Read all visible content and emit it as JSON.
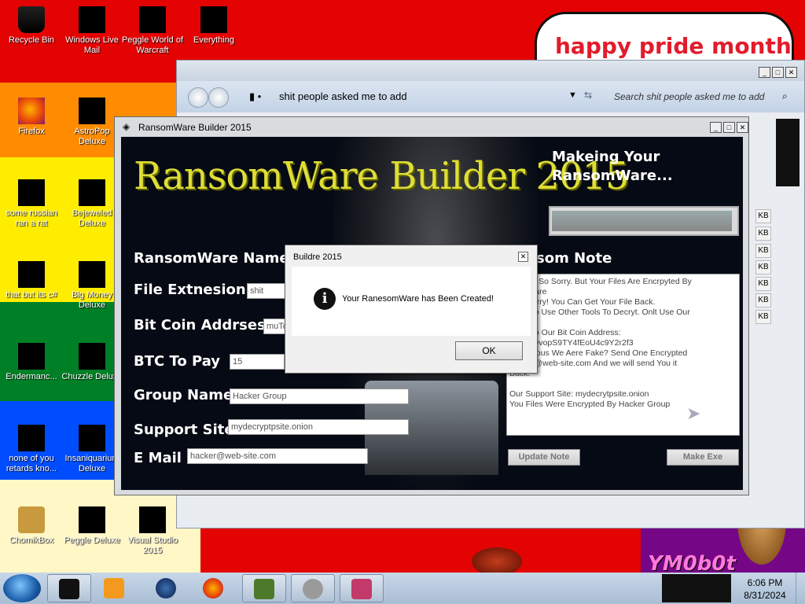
{
  "desktop": {
    "banner": "happy pride month",
    "signature": "YM0b0t",
    "icons": [
      {
        "label": "Recycle Bin",
        "icon": "recycle-bin-icon"
      },
      {
        "label": "Windows Live Mail",
        "icon": "mail-icon"
      },
      {
        "label": "Peggle World of Warcraft",
        "icon": "peggle-icon"
      },
      {
        "label": "Everything",
        "icon": "search-icon"
      },
      {
        "label": "Firefox",
        "icon": "firefox-icon"
      },
      {
        "label": "AstroPop Deluxe",
        "icon": "game-icon"
      },
      {
        "label": "some russian ran a rat",
        "icon": "ie-icon"
      },
      {
        "label": "Bejeweled Deluxe",
        "icon": "gem-icon"
      },
      {
        "label": "that but its c#",
        "icon": "shortcut-icon"
      },
      {
        "label": "Big Money Deluxe",
        "icon": "money-icon"
      },
      {
        "label": "Endermanc...",
        "icon": "app-icon"
      },
      {
        "label": "Chuzzle Deluxe",
        "icon": "chuzzle-icon"
      },
      {
        "label": "none of you retards kno...",
        "icon": "folder-icon"
      },
      {
        "label": "Insaniquarium Deluxe",
        "icon": "fish-icon"
      },
      {
        "label": "ChomikBox",
        "icon": "hamster-icon"
      },
      {
        "label": "Peggle Deluxe",
        "icon": "peggle-icon"
      },
      {
        "label": "Visual Studio 2015",
        "icon": "visual-studio-icon"
      }
    ]
  },
  "explorer": {
    "address": "shit people asked me to add",
    "search_placeholder": "Search shit people asked me to add",
    "size_unit": "KB"
  },
  "builder": {
    "window_title": "RansomWare Builder 2015",
    "logo": "RansomWare Builder 2015",
    "status_title": "Makeing Your RansomWare...",
    "progress": 0.98,
    "fields": {
      "ransomware_name_label": "RansomWare Name",
      "file_extension_label": "File Extnesion",
      "file_extension_value": "shit",
      "bitcoin_address_label": "Bit Coin Addrses",
      "bitcoin_address_value": "muTc",
      "btc_to_pay_label": "BTC To Pay",
      "btc_to_pay_value": "15",
      "group_name_label": "Group Name",
      "group_name_value": "Hacker Group",
      "support_site_label": "Support Site",
      "support_site_value": "mydecryptpsite.onion",
      "email_label": "E Mail",
      "email_value": "hacker@web-site.com"
    },
    "note_label": "som Note",
    "note_lines": [
      "We Are So Sorry. But Your Files Are Encrpyted By",
      "som Ware",
      "Not Worry! You Can Get Your File Back.",
      "T Try To Use Other Tools To Decryt. Onlt Use Our",
      "",
      "5 Btc To Our Bit Coin Address:",
      "VZoBfQvopS9TY4fEoU4c9Y2r2f3",
      "Suspicious We Aere Fake? Send One Encrypted",
      "hacker@web-site.com And we will send You it",
      "Back.",
      "",
      "Our Support Site: mydecrytpsite.onion",
      "You Files Were Encrypted By Hacker Group"
    ],
    "update_note_label": "Update Note",
    "make_exe_label": "Make Exe"
  },
  "dialog": {
    "title": "Buildre 2015",
    "message": "Your RanesomWare has Been Created!",
    "ok_label": "OK"
  },
  "taskbar": {
    "time": "6:06 PM",
    "date": "8/31/2024",
    "buttons": [
      "explorer",
      "media-player",
      "globe",
      "firefox",
      "minecraft",
      "skull-app",
      "screen-app"
    ]
  }
}
